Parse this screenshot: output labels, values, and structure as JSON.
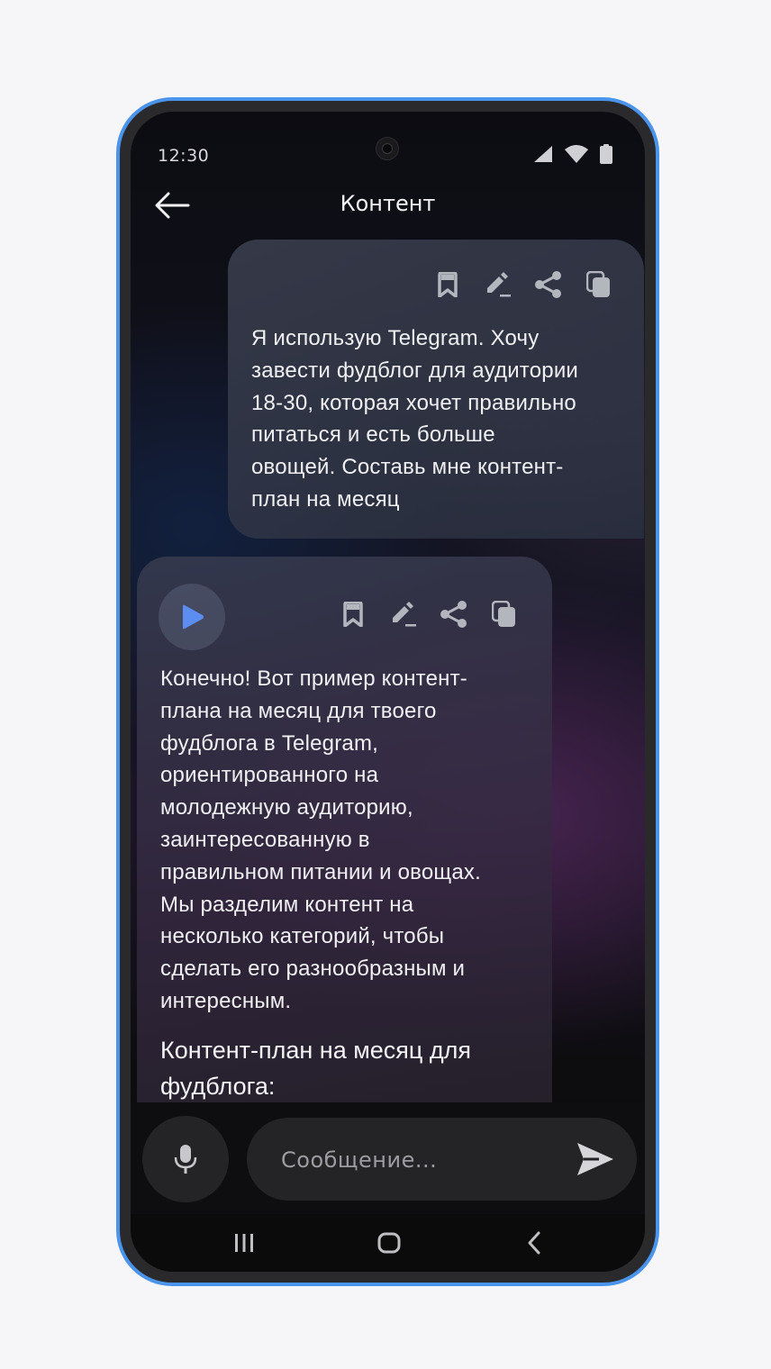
{
  "status_bar": {
    "time": "12:30",
    "icons": [
      "signal-icon",
      "wifi-icon",
      "battery-icon"
    ]
  },
  "app_bar": {
    "title": "Контент",
    "back_icon": "arrow-left-icon"
  },
  "messages": [
    {
      "role": "user",
      "actions": [
        "bookmark-icon",
        "edit-icon",
        "share-icon",
        "copy-icon"
      ],
      "lines": [
        "Я использую Telegram. Хочу",
        "завести фудблог для аудитории",
        "18-30, которая хочет правильно",
        "питаться и есть больше",
        "овощей. Составь мне контент-",
        "план на месяц"
      ]
    },
    {
      "role": "assistant",
      "play_icon": "play-icon",
      "actions": [
        "bookmark-icon",
        "edit-icon",
        "share-icon",
        "copy-icon"
      ],
      "lines": [
        "Конечно! Вот пример контент-",
        "плана на месяц для твоего",
        "фудблога в Telegram,",
        "ориентированного на",
        "молодежную аудиторию,",
        "заинтересованную в",
        "правильном питании и овощах.",
        "Мы разделим контент на",
        "несколько категорий, чтобы",
        "сделать его разнообразным и",
        "интересным."
      ],
      "heading_lines": [
        "Контент-план на месяц для",
        "фудблога:"
      ]
    }
  ],
  "composer": {
    "placeholder": "Сообщение...",
    "value": "",
    "mic_icon": "microphone-icon",
    "send_icon": "send-icon"
  },
  "nav_bar": {
    "icons": [
      "recent-apps-icon",
      "home-icon",
      "back-icon"
    ]
  },
  "colors": {
    "frame_accent": "#4a94ec",
    "play_accent": "#5b8ef0",
    "bubble": "#3a4050",
    "input_bg": "#242426"
  }
}
